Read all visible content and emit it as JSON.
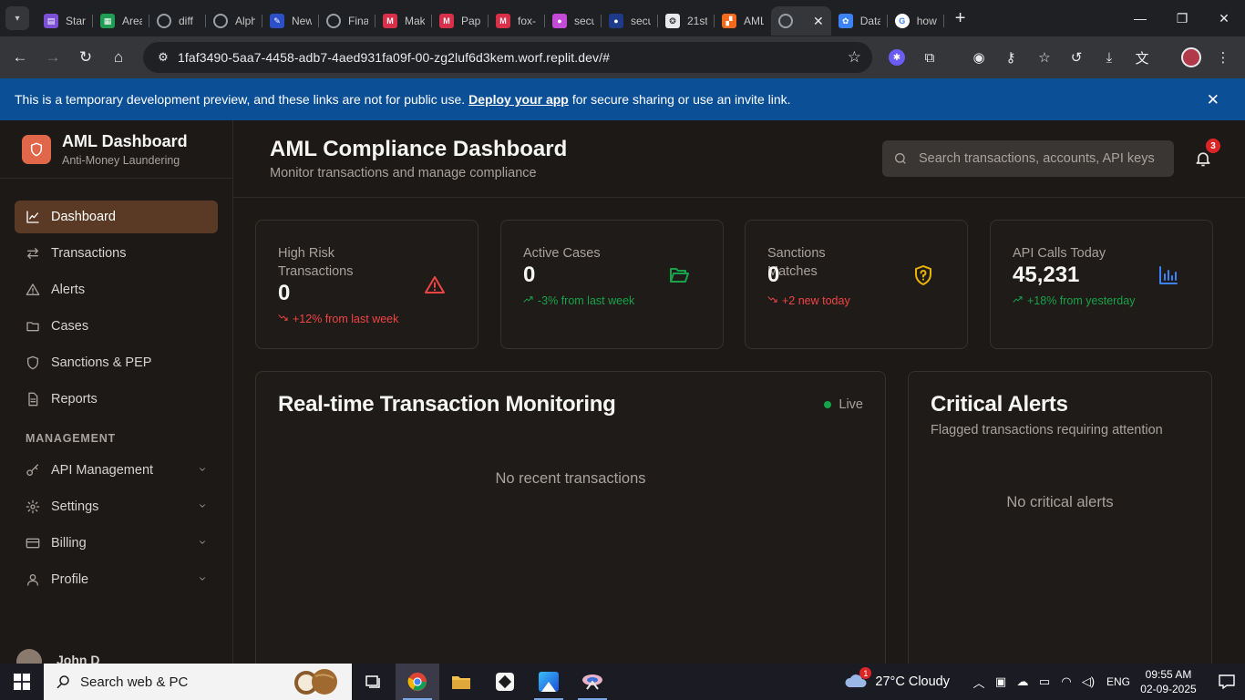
{
  "browser": {
    "tabs": [
      {
        "label": "Start",
        "color": "#7b4fd6",
        "glyph": "▤"
      },
      {
        "label": "Area",
        "color": "#1f9d55",
        "glyph": "▦"
      },
      {
        "label": "diff",
        "color": "#5f6368",
        "glyph": "◍"
      },
      {
        "label": "Alph",
        "color": "#5f6368",
        "glyph": "◍"
      },
      {
        "label": "New",
        "color": "#2b50c8",
        "glyph": "✎"
      },
      {
        "label": "Fina",
        "color": "#5f6368",
        "glyph": "◍"
      },
      {
        "label": "Mak",
        "color": "#d9304a",
        "glyph": "M"
      },
      {
        "label": "Pap",
        "color": "#d9304a",
        "glyph": "M"
      },
      {
        "label": "fox-",
        "color": "#d9304a",
        "glyph": "M"
      },
      {
        "label": "secu",
        "color": "#c44bd8",
        "glyph": "●"
      },
      {
        "label": "secu",
        "color": "#1e3a8a",
        "glyph": "●"
      },
      {
        "label": "21st",
        "color": "#e8eaed",
        "glyph": "❂"
      },
      {
        "label": "AML",
        "color": "#f26b1d",
        "glyph": "▞"
      },
      {
        "label": "",
        "color": "#5f6368",
        "glyph": "◍"
      },
      {
        "label": "Data",
        "color": "#3b82f6",
        "glyph": "✿"
      },
      {
        "label": "how",
        "color": "#ffffff",
        "glyph": "G"
      }
    ],
    "url": "1faf3490-5aa7-4458-adb7-4aed931fa09f-00-zg2luf6d3kem.worf.replit.dev/#"
  },
  "banner": {
    "text_before": "This is a temporary development preview, and these links are not for public use.",
    "link": "Deploy your app",
    "text_after": "for secure sharing or use an invite link."
  },
  "sidebar": {
    "brand_title": "AML Dashboard",
    "brand_subtitle": "Anti-Money Laundering",
    "items": [
      {
        "label": "Dashboard",
        "icon": "chart-line-icon"
      },
      {
        "label": "Transactions",
        "icon": "arrows-left-right-icon"
      },
      {
        "label": "Alerts",
        "icon": "warning-triangle-icon"
      },
      {
        "label": "Cases",
        "icon": "folder-icon"
      },
      {
        "label": "Sanctions & PEP",
        "icon": "shield-icon"
      },
      {
        "label": "Reports",
        "icon": "document-icon"
      }
    ],
    "section_label": "MANAGEMENT",
    "management": [
      {
        "label": "API Management",
        "icon": "key-icon"
      },
      {
        "label": "Settings",
        "icon": "gear-icon"
      },
      {
        "label": "Billing",
        "icon": "credit-card-icon"
      },
      {
        "label": "Profile",
        "icon": "user-icon"
      }
    ],
    "user_name_partial": "John D"
  },
  "header": {
    "title": "AML Compliance Dashboard",
    "subtitle": "Monitor transactions and manage compliance",
    "search_placeholder": "Search transactions, accounts, API keys",
    "notification_count": "3"
  },
  "stats": [
    {
      "label": "High Risk Transactions",
      "value": "0",
      "trend": "+12% from last week",
      "trend_dir": "down",
      "icon": "alert-triangle-icon",
      "icon_color": "#ef4444"
    },
    {
      "label": "Active Cases",
      "value": "0",
      "trend": "-3% from last week",
      "trend_dir": "up",
      "icon": "folder-open-icon",
      "icon_color": "#16a34a"
    },
    {
      "label": "Sanctions Matches",
      "value": "0",
      "trend": "+2 new today",
      "trend_dir": "down",
      "icon": "shield-question-icon",
      "icon_color": "#eab308"
    },
    {
      "label": "API Calls Today",
      "value": "45,231",
      "trend": "+18% from yesterday",
      "trend_dir": "up",
      "icon": "bar-chart-icon",
      "icon_color": "#3b82f6"
    }
  ],
  "monitoring": {
    "title": "Real-time Transaction Monitoring",
    "live_label": "Live",
    "empty": "No recent transactions"
  },
  "alerts_panel": {
    "title": "Critical Alerts",
    "subtitle": "Flagged transactions requiring attention",
    "empty": "No critical alerts"
  },
  "taskbar": {
    "search_placeholder": "Search web & PC",
    "weather": "27°C  Cloudy",
    "weather_badge": "1",
    "language": "ENG",
    "time": "09:55 AM",
    "date": "02-09-2025"
  },
  "colors": {
    "accent": "#e0674a",
    "active_nav": "#5a3a24",
    "banner": "#0b4f96",
    "positive": "#16a34a",
    "negative": "#ef4444"
  }
}
